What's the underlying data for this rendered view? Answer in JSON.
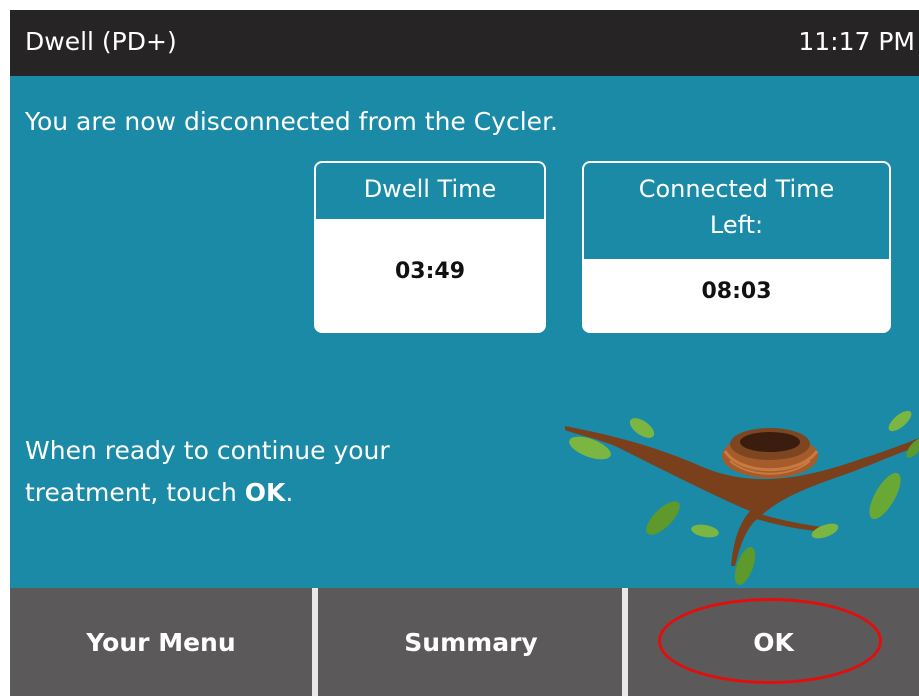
{
  "header": {
    "title": "Dwell (PD+)",
    "time": "11:17 PM"
  },
  "main": {
    "message": "You are now disconnected from the Cycler.",
    "cards": [
      {
        "label": "Dwell Time",
        "value": "03:49"
      },
      {
        "label_lines": [
          "Connected Time",
          "Left:"
        ],
        "value": "08:03"
      }
    ],
    "continue_text_pre": "When ready to continue your",
    "continue_text_mid": "treatment, touch ",
    "continue_text_bold": "OK",
    "continue_text_post": "."
  },
  "footer": {
    "buttons": [
      "Your Menu",
      "Summary",
      "OK"
    ]
  },
  "colors": {
    "header": "#272426",
    "main": "#1a8aa6",
    "footer": "#5b595a",
    "highlight": "#e40d0d"
  },
  "icons": {
    "illustration": "bird-nest-branch-icon"
  }
}
